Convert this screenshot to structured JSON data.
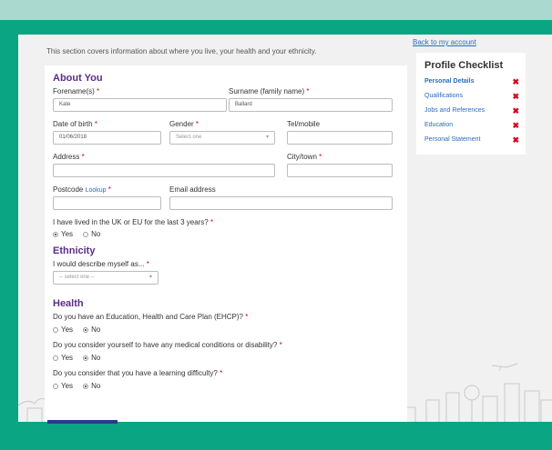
{
  "intro_text": "This section covers information about where you live, your health and your ethnicity.",
  "back_link": "Back to my account",
  "about": {
    "title": "About You",
    "forename_label": "Forename(s)",
    "forename_value": "Kate",
    "surname_label": "Surname (family name)",
    "surname_value": "Ballard",
    "dob_label": "Date of birth",
    "dob_value": "01/06/2018",
    "gender_label": "Gender",
    "gender_placeholder": "Select one",
    "tel_label": "Tel/mobile",
    "address_label": "Address",
    "city_label": "City/town",
    "postcode_label": "Postcode",
    "lookup_label": "Lookup",
    "email_label": "Email address",
    "uk_question": "I have lived in the UK or EU for the last 3 years?",
    "uk_yes": "Yes",
    "uk_no": "No",
    "uk_selected": "Yes"
  },
  "ethnicity": {
    "title": "Ethnicity",
    "label": "I would describe myself as...",
    "placeholder": "-- select one --"
  },
  "health": {
    "title": "Health",
    "q1": "Do you have an Education, Health and Care Plan (EHCP)?",
    "q2": "Do you consider yourself to have any medical conditions or disability?",
    "q3": "Do you consider that you have a learning difficulty?",
    "yes": "Yes",
    "no": "No",
    "q1_selected": "No",
    "q2_selected": "No",
    "q3_selected": "No"
  },
  "required_mark": "*",
  "caret_icon": "▾",
  "checklist": {
    "title": "Profile Checklist",
    "items": [
      {
        "label": "Personal Details",
        "status": "incomplete",
        "icon": "cross-icon"
      },
      {
        "label": "Qualifications",
        "status": "incomplete",
        "icon": "cross-icon"
      },
      {
        "label": "Jobs and References",
        "status": "incomplete",
        "icon": "cross-icon"
      },
      {
        "label": "Education",
        "status": "incomplete",
        "icon": "cross-icon"
      },
      {
        "label": "Personal Statement",
        "status": "incomplete",
        "icon": "cross-icon"
      }
    ],
    "cross_glyph": "✖"
  },
  "colors": {
    "page_background": "#0aa583",
    "heading": "#5b2d86",
    "link": "#2a6bbf",
    "required": "#d6001c",
    "submit": "#2b3a8c"
  }
}
